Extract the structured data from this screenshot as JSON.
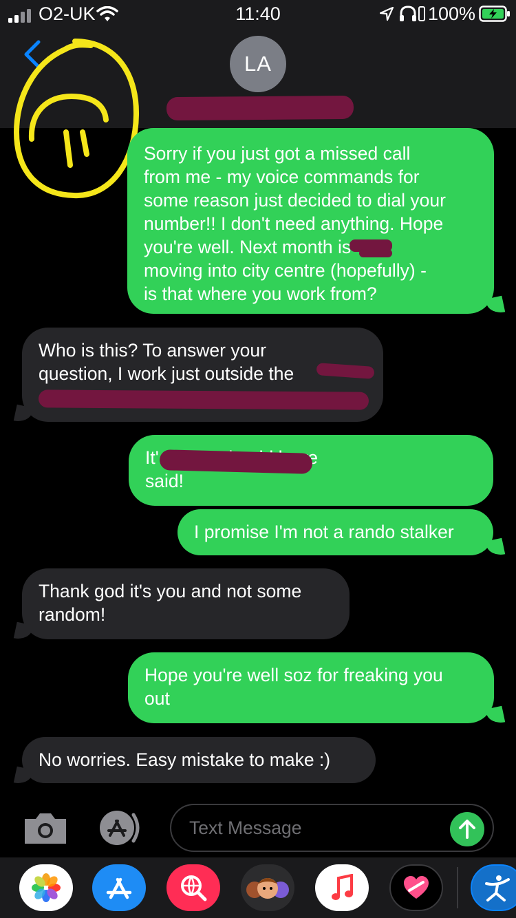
{
  "status_bar": {
    "carrier": "O2-UK",
    "time": "11:40",
    "battery": "100%"
  },
  "header": {
    "contact_initials": "LA",
    "back_label": "<"
  },
  "messages": [
    {
      "from": "me",
      "text": "Sorry if you just got a missed call\nfrom me - my voice commands for\nsome reason just decided to dial your\nnumber!! I don't need anything. Hope\nyou're well. Next month           is\nmoving into city centre (hopefully) -\nis that where you work from?"
    },
    {
      "from": "them",
      "text": "Who is this? To answer your\nquestion, I work just outside the"
    },
    {
      "from": "me",
      "text": "It'                                       sorry I should have\nsaid!"
    },
    {
      "from": "me",
      "text": "I promise I'm not a rando stalker"
    },
    {
      "from": "them",
      "text": "Thank god it's you and not some\nrandom!"
    },
    {
      "from": "me",
      "text": "Hope you're well soz for freaking you\nout"
    },
    {
      "from": "them",
      "text": "No worries. Easy mistake to make :)"
    }
  ],
  "composer": {
    "placeholder": "Text Message"
  },
  "colors": {
    "sent_bubble": "#32d158",
    "received_bubble": "#262629",
    "redaction": "#73163f",
    "annotation": "#f5e61a",
    "accent_blue": "#0a84ff"
  },
  "app_drawer": [
    "photos-icon",
    "app-store-icon",
    "web-search-icon",
    "memoji-icon",
    "music-icon",
    "heart-sticker-icon",
    "fitness-app-icon"
  ]
}
